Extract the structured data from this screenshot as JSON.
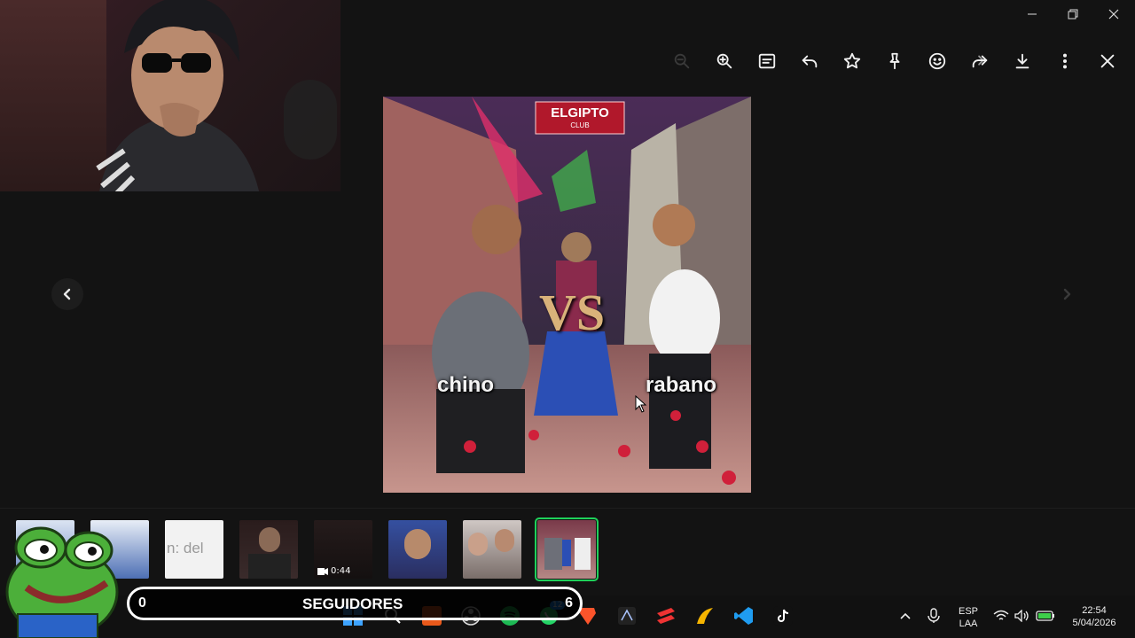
{
  "window": {
    "minimize_icon": "minimize-icon",
    "restore_icon": "restore-icon",
    "close_icon": "close-icon"
  },
  "toolbar": {
    "items": [
      {
        "name": "zoom-out",
        "enabled": false
      },
      {
        "name": "zoom-in",
        "enabled": true
      },
      {
        "name": "caption",
        "enabled": true
      },
      {
        "name": "reply",
        "enabled": true
      },
      {
        "name": "star",
        "enabled": true
      },
      {
        "name": "pin",
        "enabled": true
      },
      {
        "name": "react",
        "enabled": true
      },
      {
        "name": "forward",
        "enabled": true
      },
      {
        "name": "download",
        "enabled": true
      },
      {
        "name": "more",
        "enabled": true
      },
      {
        "name": "close",
        "enabled": true
      }
    ]
  },
  "image": {
    "sign_text": "ELGIPTO",
    "sign_sub": "CLUB",
    "vs_text": "VS",
    "left_caption": "chino",
    "right_caption": "rabano"
  },
  "thumbnails": {
    "video_duration": "0:44",
    "text_snippet": "n: del"
  },
  "overlay": {
    "followers_count": "0",
    "followers_label": "SEGUIDORES",
    "followers_goal": "6"
  },
  "taskbar": {
    "whatsapp_badge": "12",
    "language": "ESP",
    "layout": "LAA",
    "time": "22:54",
    "date": "5/04/2026"
  },
  "colors": {
    "background": "#131313",
    "selected_outline": "#1fd15a"
  }
}
